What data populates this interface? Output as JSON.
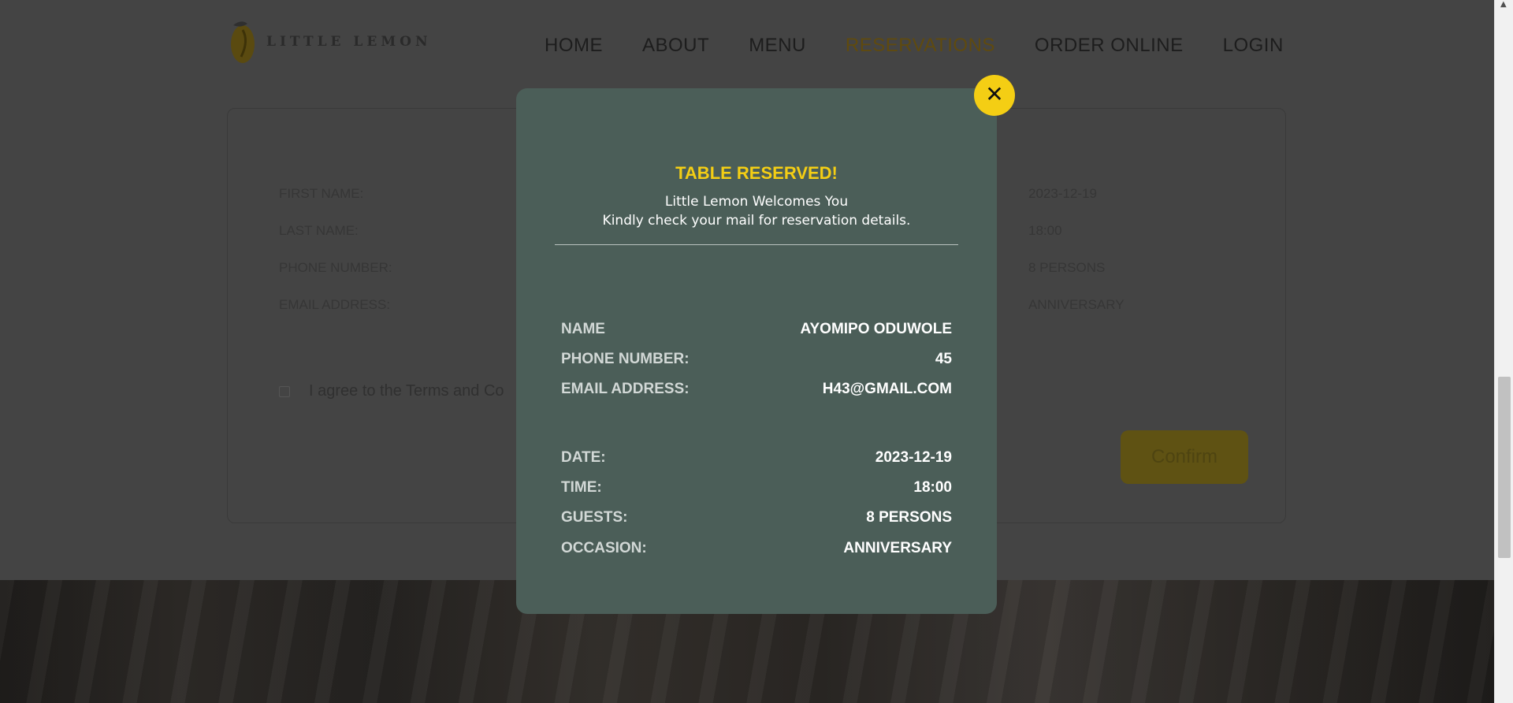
{
  "brand": {
    "name": "LITTLE LEMON"
  },
  "nav": {
    "items": [
      {
        "label": "HOME"
      },
      {
        "label": "ABOUT"
      },
      {
        "label": "MENU"
      },
      {
        "label": "RESERVATIONS",
        "active": true
      },
      {
        "label": "ORDER ONLINE"
      },
      {
        "label": "LOGIN"
      }
    ]
  },
  "form": {
    "labels": [
      "FIRST NAME:",
      "LAST NAME:",
      "PHONE NUMBER:",
      "EMAIL ADDRESS:"
    ],
    "values": [
      "2023-12-19",
      "18:00",
      "8 PERSONS",
      "ANNIVERSARY"
    ],
    "agree_text": "I agree to the Terms and Co",
    "confirm_label": "Confirm"
  },
  "modal": {
    "title": "TABLE RESERVED!",
    "welcome": "Little Lemon Welcomes You",
    "check_mail": "Kindly check your mail for reservation details.",
    "details": [
      {
        "key": "NAME",
        "value": "AYOMIPO ODUWOLE"
      },
      {
        "key": "PHONE NUMBER:",
        "value": "45"
      },
      {
        "key": "EMAIL ADDRESS:",
        "value": "H43@GMAIL.COM"
      },
      {
        "key": "DATE:",
        "value": "2023-12-19"
      },
      {
        "key": "TIME:",
        "value": "18:00"
      },
      {
        "key": "GUESTS:",
        "value": "8 PERSONS"
      },
      {
        "key": "OCCASION:",
        "value": "ANNIVERSARY"
      }
    ],
    "close_icon": "close-icon"
  },
  "colors": {
    "accent": "#F4CE14",
    "modal_bg": "#4B5E58",
    "overlay": "#444444"
  }
}
